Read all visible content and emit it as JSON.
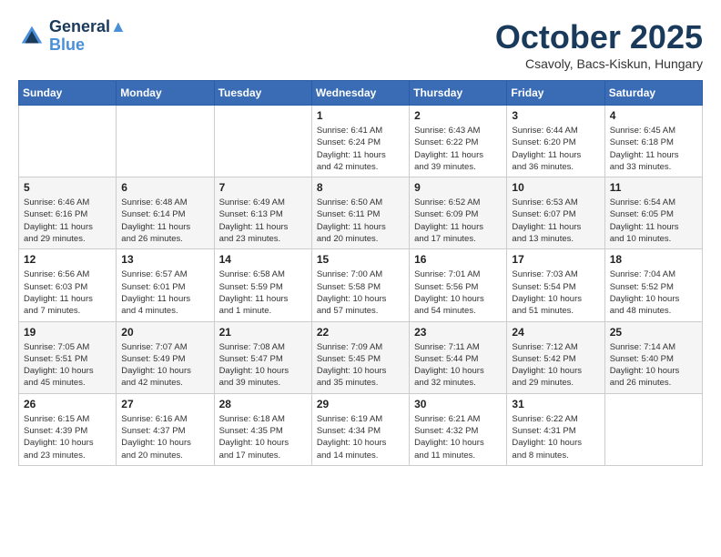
{
  "header": {
    "logo_line1": "General",
    "logo_line2": "Blue",
    "month": "October 2025",
    "location": "Csavoly, Bacs-Kiskun, Hungary"
  },
  "weekdays": [
    "Sunday",
    "Monday",
    "Tuesday",
    "Wednesday",
    "Thursday",
    "Friday",
    "Saturday"
  ],
  "weeks": [
    [
      {
        "day": "",
        "info": ""
      },
      {
        "day": "",
        "info": ""
      },
      {
        "day": "",
        "info": ""
      },
      {
        "day": "1",
        "info": "Sunrise: 6:41 AM\nSunset: 6:24 PM\nDaylight: 11 hours\nand 42 minutes."
      },
      {
        "day": "2",
        "info": "Sunrise: 6:43 AM\nSunset: 6:22 PM\nDaylight: 11 hours\nand 39 minutes."
      },
      {
        "day": "3",
        "info": "Sunrise: 6:44 AM\nSunset: 6:20 PM\nDaylight: 11 hours\nand 36 minutes."
      },
      {
        "day": "4",
        "info": "Sunrise: 6:45 AM\nSunset: 6:18 PM\nDaylight: 11 hours\nand 33 minutes."
      }
    ],
    [
      {
        "day": "5",
        "info": "Sunrise: 6:46 AM\nSunset: 6:16 PM\nDaylight: 11 hours\nand 29 minutes."
      },
      {
        "day": "6",
        "info": "Sunrise: 6:48 AM\nSunset: 6:14 PM\nDaylight: 11 hours\nand 26 minutes."
      },
      {
        "day": "7",
        "info": "Sunrise: 6:49 AM\nSunset: 6:13 PM\nDaylight: 11 hours\nand 23 minutes."
      },
      {
        "day": "8",
        "info": "Sunrise: 6:50 AM\nSunset: 6:11 PM\nDaylight: 11 hours\nand 20 minutes."
      },
      {
        "day": "9",
        "info": "Sunrise: 6:52 AM\nSunset: 6:09 PM\nDaylight: 11 hours\nand 17 minutes."
      },
      {
        "day": "10",
        "info": "Sunrise: 6:53 AM\nSunset: 6:07 PM\nDaylight: 11 hours\nand 13 minutes."
      },
      {
        "day": "11",
        "info": "Sunrise: 6:54 AM\nSunset: 6:05 PM\nDaylight: 11 hours\nand 10 minutes."
      }
    ],
    [
      {
        "day": "12",
        "info": "Sunrise: 6:56 AM\nSunset: 6:03 PM\nDaylight: 11 hours\nand 7 minutes."
      },
      {
        "day": "13",
        "info": "Sunrise: 6:57 AM\nSunset: 6:01 PM\nDaylight: 11 hours\nand 4 minutes."
      },
      {
        "day": "14",
        "info": "Sunrise: 6:58 AM\nSunset: 5:59 PM\nDaylight: 11 hours\nand 1 minute."
      },
      {
        "day": "15",
        "info": "Sunrise: 7:00 AM\nSunset: 5:58 PM\nDaylight: 10 hours\nand 57 minutes."
      },
      {
        "day": "16",
        "info": "Sunrise: 7:01 AM\nSunset: 5:56 PM\nDaylight: 10 hours\nand 54 minutes."
      },
      {
        "day": "17",
        "info": "Sunrise: 7:03 AM\nSunset: 5:54 PM\nDaylight: 10 hours\nand 51 minutes."
      },
      {
        "day": "18",
        "info": "Sunrise: 7:04 AM\nSunset: 5:52 PM\nDaylight: 10 hours\nand 48 minutes."
      }
    ],
    [
      {
        "day": "19",
        "info": "Sunrise: 7:05 AM\nSunset: 5:51 PM\nDaylight: 10 hours\nand 45 minutes."
      },
      {
        "day": "20",
        "info": "Sunrise: 7:07 AM\nSunset: 5:49 PM\nDaylight: 10 hours\nand 42 minutes."
      },
      {
        "day": "21",
        "info": "Sunrise: 7:08 AM\nSunset: 5:47 PM\nDaylight: 10 hours\nand 39 minutes."
      },
      {
        "day": "22",
        "info": "Sunrise: 7:09 AM\nSunset: 5:45 PM\nDaylight: 10 hours\nand 35 minutes."
      },
      {
        "day": "23",
        "info": "Sunrise: 7:11 AM\nSunset: 5:44 PM\nDaylight: 10 hours\nand 32 minutes."
      },
      {
        "day": "24",
        "info": "Sunrise: 7:12 AM\nSunset: 5:42 PM\nDaylight: 10 hours\nand 29 minutes."
      },
      {
        "day": "25",
        "info": "Sunrise: 7:14 AM\nSunset: 5:40 PM\nDaylight: 10 hours\nand 26 minutes."
      }
    ],
    [
      {
        "day": "26",
        "info": "Sunrise: 6:15 AM\nSunset: 4:39 PM\nDaylight: 10 hours\nand 23 minutes."
      },
      {
        "day": "27",
        "info": "Sunrise: 6:16 AM\nSunset: 4:37 PM\nDaylight: 10 hours\nand 20 minutes."
      },
      {
        "day": "28",
        "info": "Sunrise: 6:18 AM\nSunset: 4:35 PM\nDaylight: 10 hours\nand 17 minutes."
      },
      {
        "day": "29",
        "info": "Sunrise: 6:19 AM\nSunset: 4:34 PM\nDaylight: 10 hours\nand 14 minutes."
      },
      {
        "day": "30",
        "info": "Sunrise: 6:21 AM\nSunset: 4:32 PM\nDaylight: 10 hours\nand 11 minutes."
      },
      {
        "day": "31",
        "info": "Sunrise: 6:22 AM\nSunset: 4:31 PM\nDaylight: 10 hours\nand 8 minutes."
      },
      {
        "day": "",
        "info": ""
      }
    ]
  ]
}
